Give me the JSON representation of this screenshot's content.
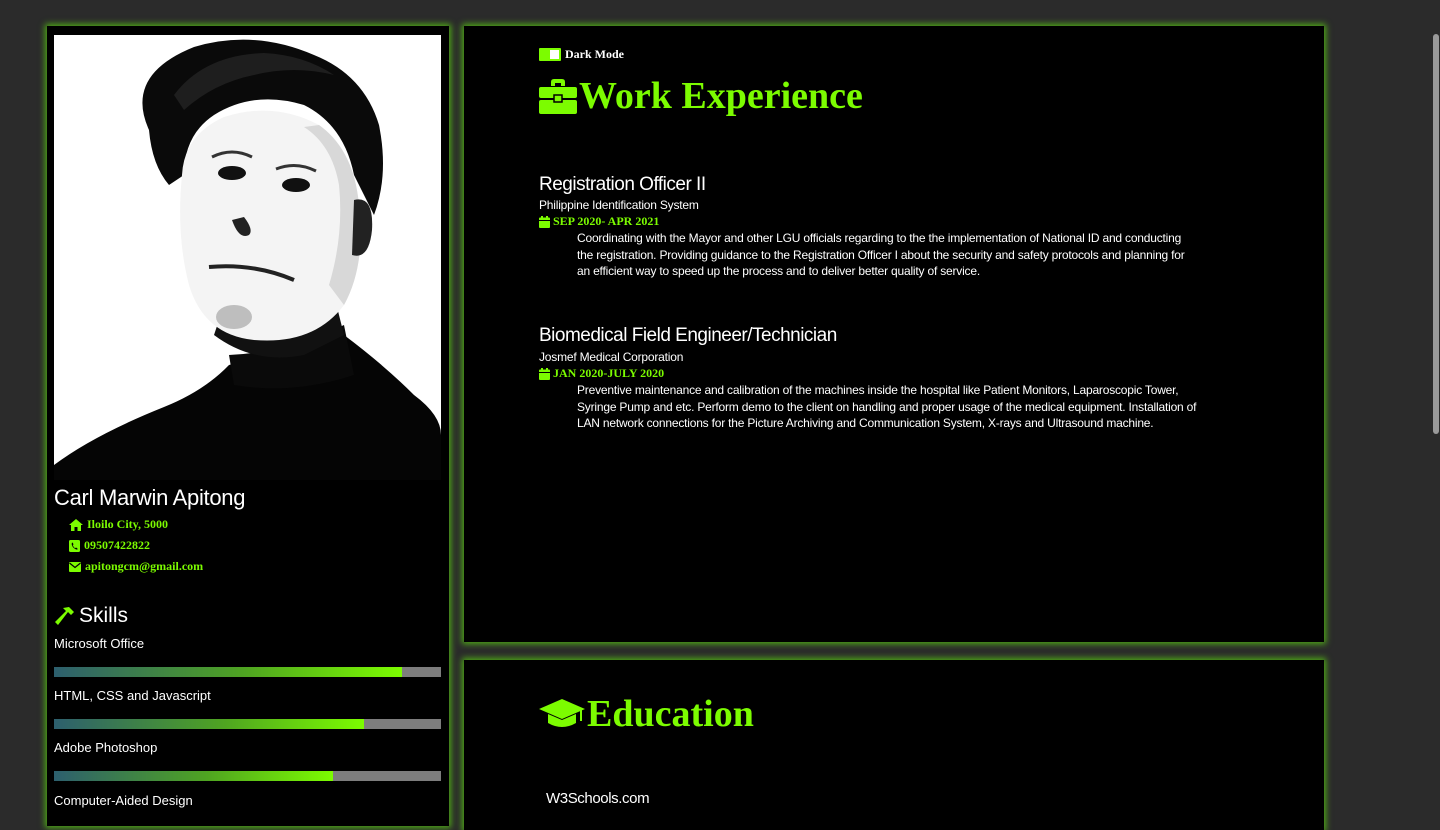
{
  "profile": {
    "name": "Carl Marwin Apitong",
    "location": "Iloilo City, 5000",
    "phone": "09507422822",
    "email": "apitongcm@gmail.com"
  },
  "skills": {
    "title": "Skills",
    "items": [
      {
        "label": "Microsoft Office",
        "level": 0.9
      },
      {
        "label": "HTML, CSS and Javascript",
        "level": 0.8
      },
      {
        "label": "Adobe Photoshop",
        "level": 0.72
      },
      {
        "label": "Computer-Aided Design",
        "level": null
      }
    ]
  },
  "dark_mode": {
    "label": "Dark Mode",
    "enabled": true
  },
  "work": {
    "title": "Work Experience",
    "jobs": [
      {
        "title": "Registration Officer II",
        "company": "Philippine Identification System",
        "date": "SEP 2020- APR 2021",
        "description": "Coordinating with the Mayor and other LGU officials regarding to the the implementation of National ID and conducting the registration. Providing guidance to the Registration Officer I about the security and safety protocols and planning for an efficient way to speed up the process and to deliver better quality of service."
      },
      {
        "title": "Biomedical Field Engineer/Technician",
        "company": "Josmef Medical Corporation",
        "date": "JAN 2020-JULY 2020",
        "description": "Preventive maintenance and calibration of the machines inside the hospital like Patient Monitors, Laparoscopic Tower, Syringe Pump and etc. Perform demo to the client on handling and proper usage of the medical equipment. Installation of LAN network connections for the Picture Archiving and Communication System, X-rays and Ultrasound machine."
      }
    ]
  },
  "education": {
    "title": "Education",
    "school": "W3Schools.com"
  },
  "colors": {
    "accent": "#7cfc00",
    "card_bg": "#000000",
    "page_bg": "#2b2b2b",
    "bar_track": "#7d7d7d"
  },
  "icons": {
    "location": "home-icon",
    "phone": "phone-icon",
    "email": "envelope-icon",
    "skills": "hammer-icon",
    "work": "briefcase-icon",
    "date": "calendar-icon",
    "education": "graduation-cap-icon"
  }
}
